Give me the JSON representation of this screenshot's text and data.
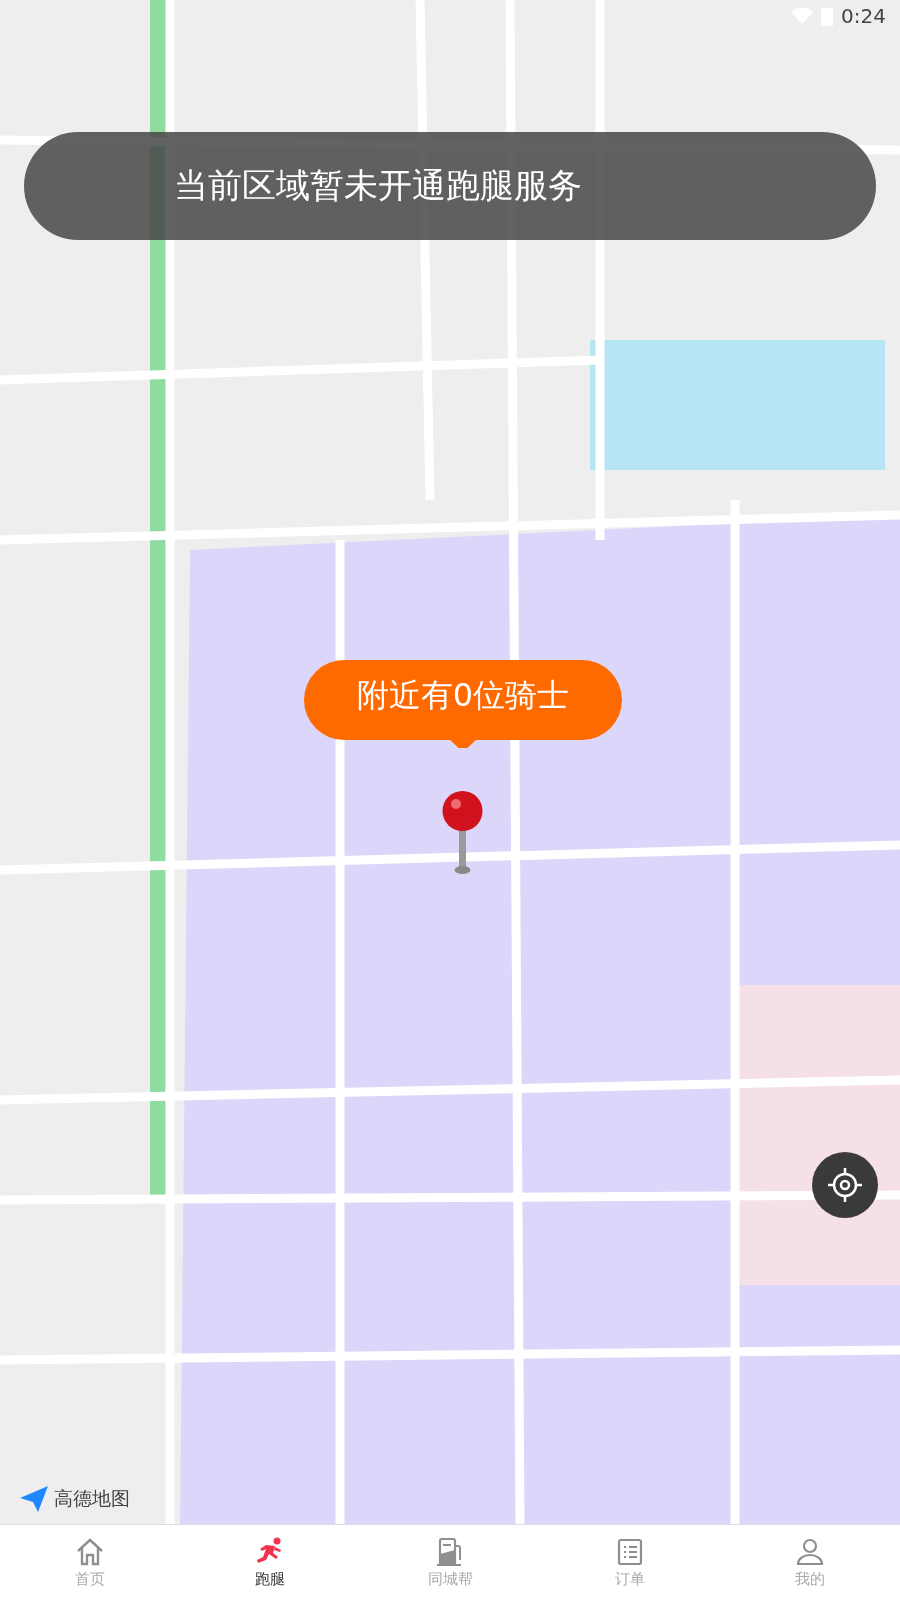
{
  "status_bar": {
    "time": "0:24"
  },
  "toast": {
    "text": "当前区域暂未开通跑腿服务"
  },
  "rider_bubble": {
    "text": "附近有0位骑士"
  },
  "map_logo": {
    "text": "高德地图"
  },
  "tab_bar": [
    {
      "kind": "home",
      "label": "首页",
      "selected": false
    },
    {
      "kind": "errand",
      "label": "跑腿",
      "selected": true
    },
    {
      "kind": "city",
      "label": "同城帮",
      "selected": false
    },
    {
      "kind": "orders",
      "label": "订单",
      "selected": false
    },
    {
      "kind": "profile",
      "label": "我的",
      "selected": false
    }
  ]
}
